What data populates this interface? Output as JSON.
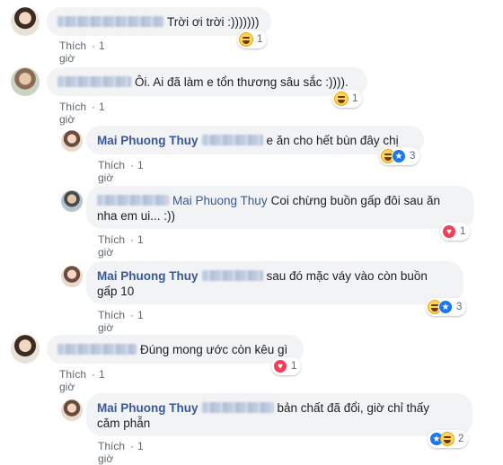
{
  "comments": [
    {
      "text": "Trời ơi trời :)))))))",
      "like": "Thích",
      "time": "1 giờ",
      "count": "1"
    },
    {
      "text": "Ôi. Ai đã làm e tổn thương sâu sắc :)))).",
      "like": "Thích",
      "time": "1 giờ",
      "count": "1"
    },
    {
      "author": "Mai Phuong Thuy",
      "text": "e ăn cho hết bùn đây chị",
      "like": "Thích",
      "time": "1 giờ",
      "count": "3"
    },
    {
      "mention": "Mai Phuong Thuy",
      "text1": "Coi chừng buồn gấp đôi sau ăn",
      "text2": "nha em ui... :))",
      "like": "Thích",
      "time": "1 giờ",
      "count": "1"
    },
    {
      "author": "Mai Phuong Thuy",
      "text1": "sau đó mặc váy vào còn buồn",
      "text2": "gấp 10",
      "like": "Thích",
      "time": "1 giờ",
      "count": "3"
    },
    {
      "text": "Đúng mong ước còn kêu gì",
      "like": "Thích",
      "time": "1 giờ",
      "count": "1"
    },
    {
      "author": "Mai Phuong Thuy",
      "text1": "bản chất đã đổi, giờ chỉ thấy",
      "text2": "căm phẫn",
      "like": "Thích",
      "time": "1 giờ",
      "count": "2"
    }
  ],
  "icons": {
    "haha": "haha-reaction-icon",
    "like": "like-reaction-icon",
    "love": "love-reaction-icon"
  },
  "colors": {
    "name": "#385898",
    "bubble": "#f2f3f5",
    "meta": "#606770",
    "like": "#1877f2",
    "love": "#f33e58"
  }
}
